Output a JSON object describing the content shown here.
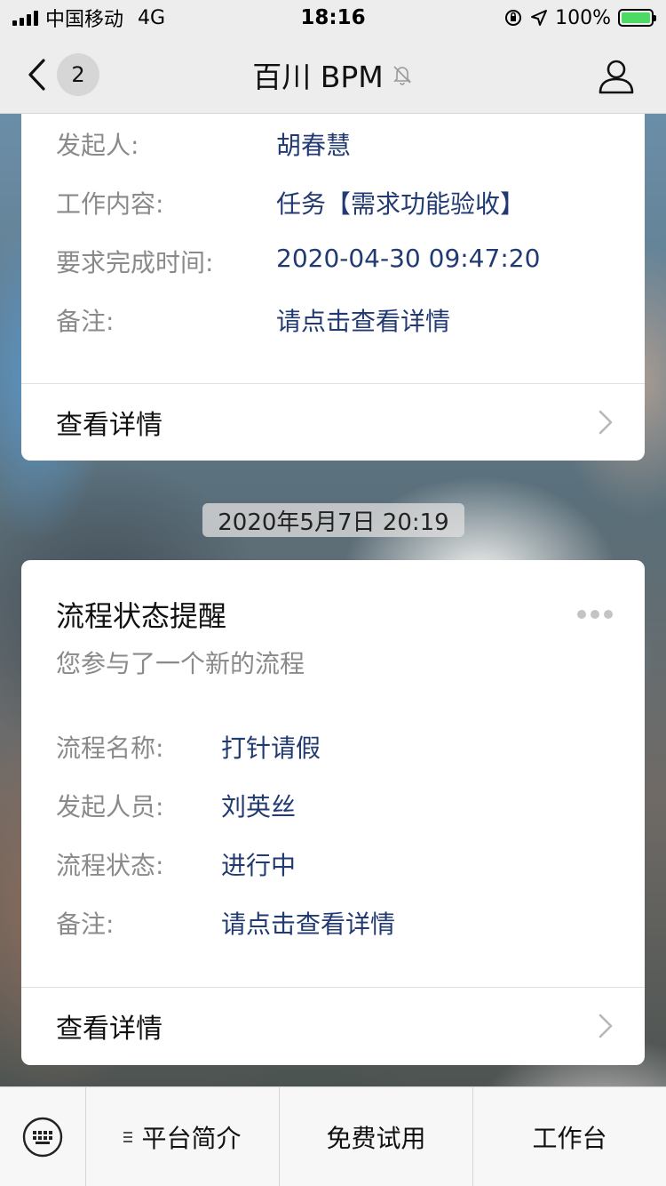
{
  "status_bar": {
    "carrier": "中国移动",
    "network": "4G",
    "time": "18:16",
    "battery": "100%"
  },
  "nav": {
    "back_badge": "2",
    "title": "百川 BPM"
  },
  "card1": {
    "fields": [
      {
        "label": "发起人:",
        "value": "胡春慧"
      },
      {
        "label": "工作内容:",
        "value": "任务【需求功能验收】"
      },
      {
        "label": "要求完成时间:",
        "value": "2020-04-30 09:47:20"
      },
      {
        "label": "备注:",
        "value": "请点击查看详情"
      }
    ],
    "detail_link": "查看详情"
  },
  "timestamp": "2020年5月7日 20:19",
  "card2": {
    "title": "流程状态提醒",
    "subtitle": "您参与了一个新的流程",
    "fields": [
      {
        "label": "流程名称:",
        "value": "打针请假"
      },
      {
        "label": "发起人员:",
        "value": "刘英丝"
      },
      {
        "label": "流程状态:",
        "value": "进行中"
      },
      {
        "label": "备注:",
        "value": "请点击查看详情"
      }
    ],
    "detail_link": "查看详情"
  },
  "bottom_menu": {
    "items": [
      "平台简介",
      "免费试用",
      "工作台"
    ]
  },
  "colors": {
    "value_blue": "#223a72",
    "label_gray": "#8a8a8a",
    "battery_green": "#4cd964"
  }
}
